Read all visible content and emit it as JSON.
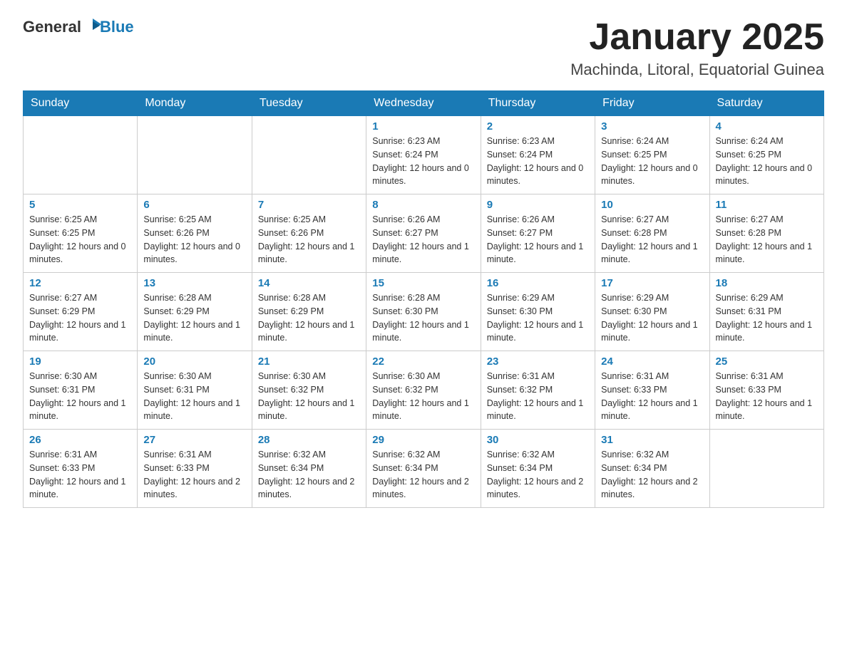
{
  "header": {
    "logo_general": "General",
    "logo_blue": "Blue",
    "title": "January 2025",
    "subtitle": "Machinda, Litoral, Equatorial Guinea"
  },
  "days_of_week": [
    "Sunday",
    "Monday",
    "Tuesday",
    "Wednesday",
    "Thursday",
    "Friday",
    "Saturday"
  ],
  "weeks": [
    [
      {
        "day": "",
        "info": ""
      },
      {
        "day": "",
        "info": ""
      },
      {
        "day": "",
        "info": ""
      },
      {
        "day": "1",
        "info": "Sunrise: 6:23 AM\nSunset: 6:24 PM\nDaylight: 12 hours and 0 minutes."
      },
      {
        "day": "2",
        "info": "Sunrise: 6:23 AM\nSunset: 6:24 PM\nDaylight: 12 hours and 0 minutes."
      },
      {
        "day": "3",
        "info": "Sunrise: 6:24 AM\nSunset: 6:25 PM\nDaylight: 12 hours and 0 minutes."
      },
      {
        "day": "4",
        "info": "Sunrise: 6:24 AM\nSunset: 6:25 PM\nDaylight: 12 hours and 0 minutes."
      }
    ],
    [
      {
        "day": "5",
        "info": "Sunrise: 6:25 AM\nSunset: 6:25 PM\nDaylight: 12 hours and 0 minutes."
      },
      {
        "day": "6",
        "info": "Sunrise: 6:25 AM\nSunset: 6:26 PM\nDaylight: 12 hours and 0 minutes."
      },
      {
        "day": "7",
        "info": "Sunrise: 6:25 AM\nSunset: 6:26 PM\nDaylight: 12 hours and 1 minute."
      },
      {
        "day": "8",
        "info": "Sunrise: 6:26 AM\nSunset: 6:27 PM\nDaylight: 12 hours and 1 minute."
      },
      {
        "day": "9",
        "info": "Sunrise: 6:26 AM\nSunset: 6:27 PM\nDaylight: 12 hours and 1 minute."
      },
      {
        "day": "10",
        "info": "Sunrise: 6:27 AM\nSunset: 6:28 PM\nDaylight: 12 hours and 1 minute."
      },
      {
        "day": "11",
        "info": "Sunrise: 6:27 AM\nSunset: 6:28 PM\nDaylight: 12 hours and 1 minute."
      }
    ],
    [
      {
        "day": "12",
        "info": "Sunrise: 6:27 AM\nSunset: 6:29 PM\nDaylight: 12 hours and 1 minute."
      },
      {
        "day": "13",
        "info": "Sunrise: 6:28 AM\nSunset: 6:29 PM\nDaylight: 12 hours and 1 minute."
      },
      {
        "day": "14",
        "info": "Sunrise: 6:28 AM\nSunset: 6:29 PM\nDaylight: 12 hours and 1 minute."
      },
      {
        "day": "15",
        "info": "Sunrise: 6:28 AM\nSunset: 6:30 PM\nDaylight: 12 hours and 1 minute."
      },
      {
        "day": "16",
        "info": "Sunrise: 6:29 AM\nSunset: 6:30 PM\nDaylight: 12 hours and 1 minute."
      },
      {
        "day": "17",
        "info": "Sunrise: 6:29 AM\nSunset: 6:30 PM\nDaylight: 12 hours and 1 minute."
      },
      {
        "day": "18",
        "info": "Sunrise: 6:29 AM\nSunset: 6:31 PM\nDaylight: 12 hours and 1 minute."
      }
    ],
    [
      {
        "day": "19",
        "info": "Sunrise: 6:30 AM\nSunset: 6:31 PM\nDaylight: 12 hours and 1 minute."
      },
      {
        "day": "20",
        "info": "Sunrise: 6:30 AM\nSunset: 6:31 PM\nDaylight: 12 hours and 1 minute."
      },
      {
        "day": "21",
        "info": "Sunrise: 6:30 AM\nSunset: 6:32 PM\nDaylight: 12 hours and 1 minute."
      },
      {
        "day": "22",
        "info": "Sunrise: 6:30 AM\nSunset: 6:32 PM\nDaylight: 12 hours and 1 minute."
      },
      {
        "day": "23",
        "info": "Sunrise: 6:31 AM\nSunset: 6:32 PM\nDaylight: 12 hours and 1 minute."
      },
      {
        "day": "24",
        "info": "Sunrise: 6:31 AM\nSunset: 6:33 PM\nDaylight: 12 hours and 1 minute."
      },
      {
        "day": "25",
        "info": "Sunrise: 6:31 AM\nSunset: 6:33 PM\nDaylight: 12 hours and 1 minute."
      }
    ],
    [
      {
        "day": "26",
        "info": "Sunrise: 6:31 AM\nSunset: 6:33 PM\nDaylight: 12 hours and 1 minute."
      },
      {
        "day": "27",
        "info": "Sunrise: 6:31 AM\nSunset: 6:33 PM\nDaylight: 12 hours and 2 minutes."
      },
      {
        "day": "28",
        "info": "Sunrise: 6:32 AM\nSunset: 6:34 PM\nDaylight: 12 hours and 2 minutes."
      },
      {
        "day": "29",
        "info": "Sunrise: 6:32 AM\nSunset: 6:34 PM\nDaylight: 12 hours and 2 minutes."
      },
      {
        "day": "30",
        "info": "Sunrise: 6:32 AM\nSunset: 6:34 PM\nDaylight: 12 hours and 2 minutes."
      },
      {
        "day": "31",
        "info": "Sunrise: 6:32 AM\nSunset: 6:34 PM\nDaylight: 12 hours and 2 minutes."
      },
      {
        "day": "",
        "info": ""
      }
    ]
  ]
}
